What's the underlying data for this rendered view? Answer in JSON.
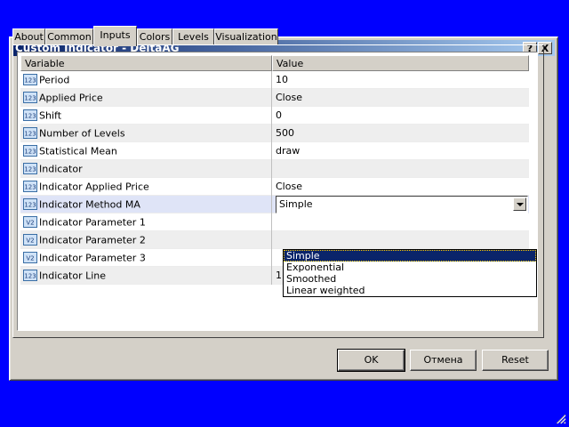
{
  "window": {
    "title": "Custom Indicator - DeltaAG",
    "help_glyph": "?",
    "close_glyph": "X"
  },
  "tabs": [
    {
      "label": "About",
      "active": false
    },
    {
      "label": "Common",
      "active": false
    },
    {
      "label": "Inputs",
      "active": true
    },
    {
      "label": "Colors",
      "active": false
    },
    {
      "label": "Levels",
      "active": false
    },
    {
      "label": "Visualization",
      "active": false
    }
  ],
  "table": {
    "headers": {
      "variable": "Variable",
      "value": "Value"
    },
    "rows": [
      {
        "icon": "int-123-icon",
        "name": "Period",
        "value": "10"
      },
      {
        "icon": "int-123-icon",
        "name": "Applied Price",
        "value": "Close"
      },
      {
        "icon": "int-123-icon",
        "name": "Shift",
        "value": "0"
      },
      {
        "icon": "int-123-icon",
        "name": "Number of Levels",
        "value": "500"
      },
      {
        "icon": "int-123-icon",
        "name": "Statistical Mean",
        "value": "draw"
      },
      {
        "icon": "int-123-icon",
        "name": "Indicator",
        "value": ""
      },
      {
        "icon": "int-123-icon",
        "name": "Indicator Applied Price",
        "value": "Close"
      },
      {
        "icon": "int-123-icon",
        "name": "Indicator Method MA",
        "value": "Simple"
      },
      {
        "icon": "double-v2-icon",
        "name": "Indicator Parameter 1",
        "value": ""
      },
      {
        "icon": "double-v2-icon",
        "name": "Indicator Parameter 2",
        "value": ""
      },
      {
        "icon": "double-v2-icon",
        "name": "Indicator Parameter 3",
        "value": ""
      },
      {
        "icon": "int-123-icon",
        "name": "Indicator Line",
        "value": "1"
      }
    ]
  },
  "dropdown": {
    "options": [
      "Simple",
      "Exponential",
      "Smoothed",
      "Linear weighted"
    ],
    "selected": "Simple"
  },
  "buttons": {
    "ok": "OK",
    "cancel": "Отмена",
    "reset": "Reset"
  },
  "icons": {
    "int_label": "123",
    "double_label": "V2"
  },
  "colors": {
    "desktop": "#0000ff",
    "title_start": "#0a246a",
    "title_end": "#a6caf0",
    "face": "#d4d0c8",
    "selection": "#0a246a"
  }
}
